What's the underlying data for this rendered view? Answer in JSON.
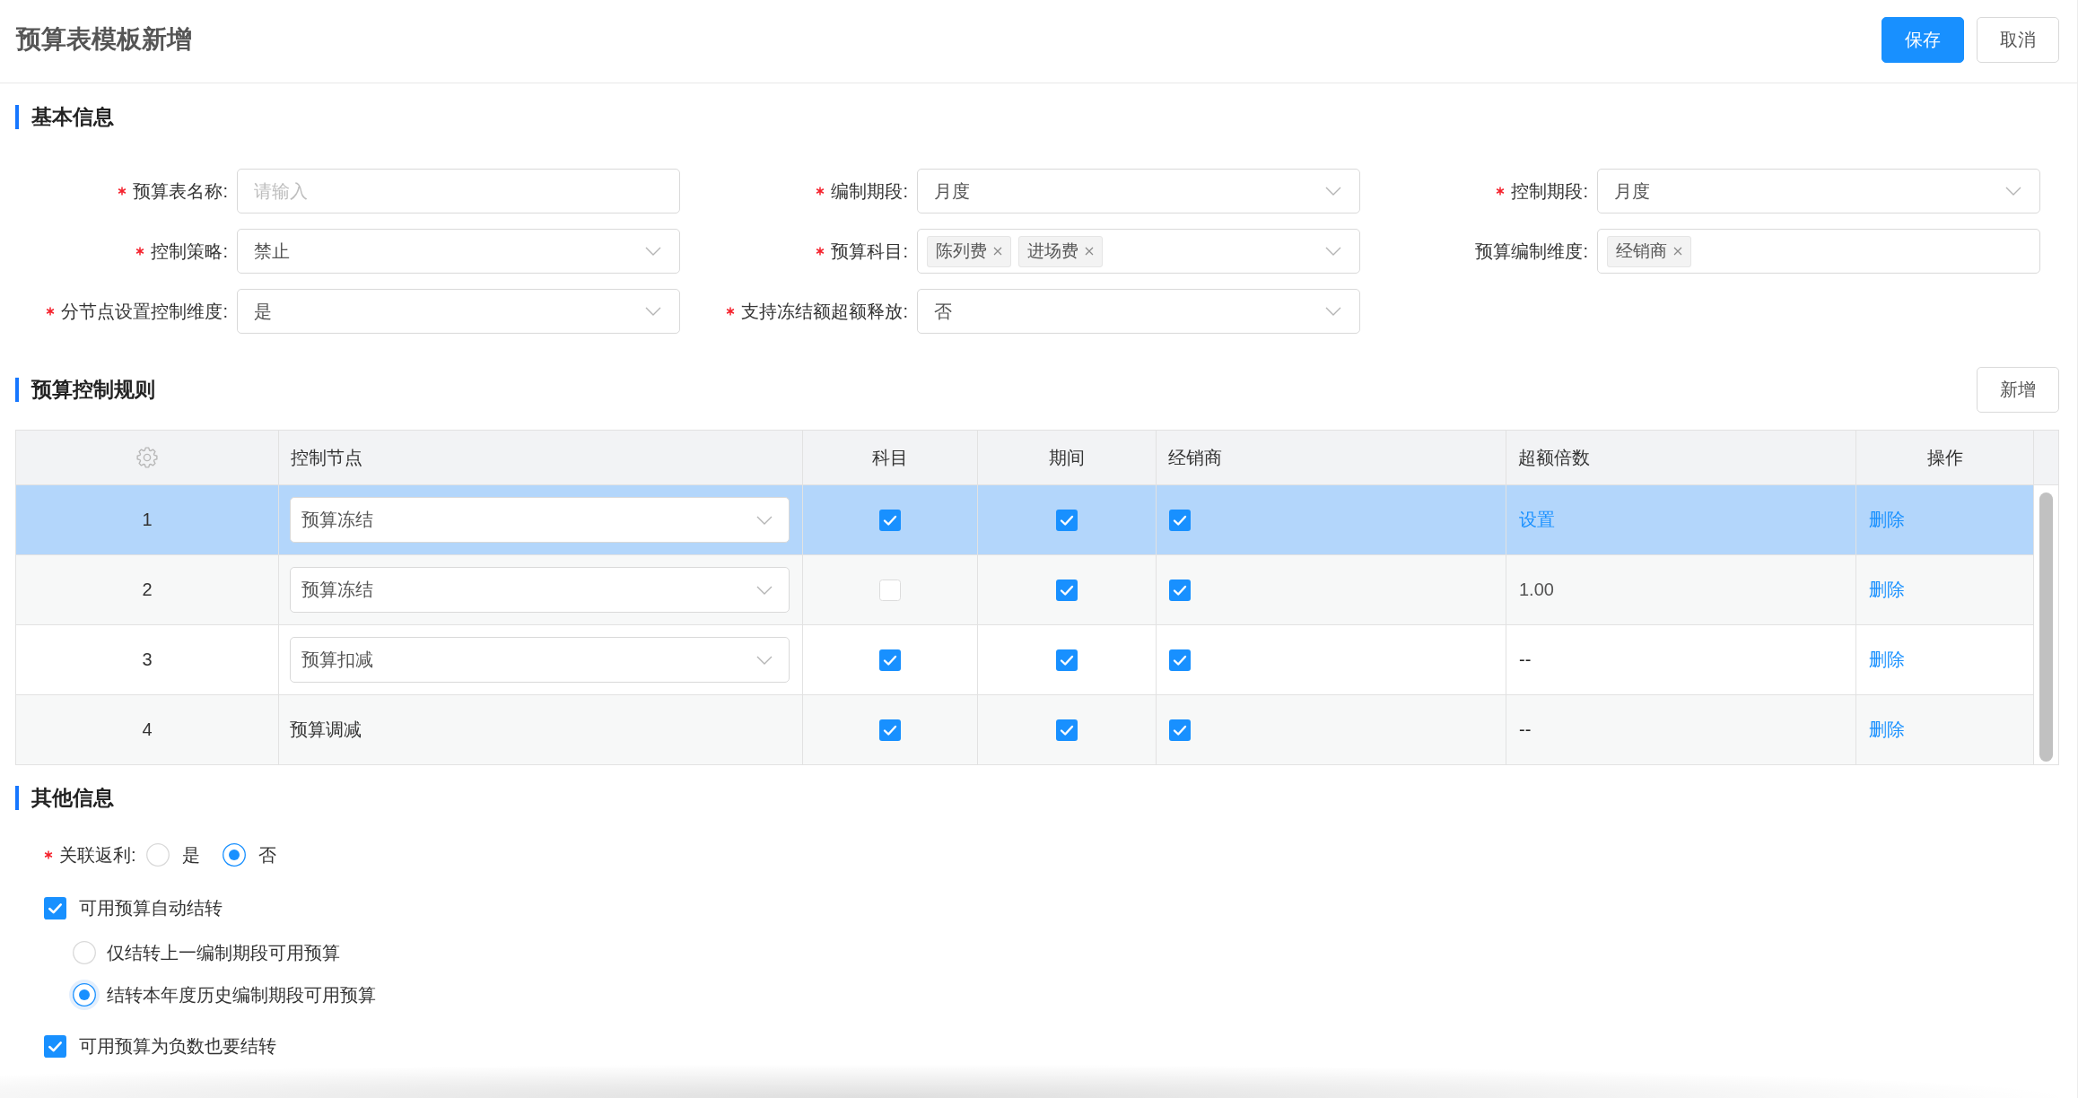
{
  "header": {
    "title": "预算表模板新增",
    "buttons": [
      {
        "label": "保存",
        "kind": "primary"
      },
      {
        "label": "取消",
        "kind": "default"
      }
    ]
  },
  "basic_info": {
    "title": "基本信息",
    "fields": [
      {
        "label": "预算表名称:",
        "required": true,
        "kind": "input",
        "placeholder": "请输入"
      },
      {
        "label": "编制期段:",
        "required": true,
        "kind": "select",
        "value": "月度"
      },
      {
        "label": "控制期段:",
        "required": true,
        "kind": "select",
        "value": "月度"
      },
      {
        "label": "控制策略:",
        "required": true,
        "kind": "select",
        "value": "禁止"
      },
      {
        "label": "预算科目:",
        "required": true,
        "kind": "tag_select",
        "tags": [
          "陈列费",
          "进场费"
        ]
      },
      {
        "label": "预算编制维度:",
        "required": false,
        "kind": "tag_input",
        "tags": [
          "经销商"
        ]
      },
      {
        "label": "分节点设置控制维度:",
        "required": true,
        "kind": "select",
        "value": "是"
      },
      {
        "label": "支持冻结额超额释放:",
        "required": true,
        "kind": "select",
        "value": "否"
      }
    ]
  },
  "control_rules": {
    "title": "预算控制规则",
    "add_button": "新增",
    "table": {
      "columns": [
        "控制节点",
        "科目",
        "期间",
        "经销商",
        "超额倍数",
        "操作"
      ],
      "rows": [
        {
          "number": "1",
          "selected": true,
          "node": {
            "kind": "select",
            "value": "预算冻结"
          },
          "subject_checked": true,
          "period_checked": true,
          "dealer_checked": true,
          "excess": {
            "kind": "link",
            "value": "设置"
          },
          "action": "删除"
        },
        {
          "number": "2",
          "selected": false,
          "node": {
            "kind": "select",
            "value": "预算冻结"
          },
          "subject_checked": false,
          "period_checked": true,
          "dealer_checked": true,
          "excess": {
            "kind": "number",
            "value": "1.00"
          },
          "action": "删除"
        },
        {
          "number": "3",
          "selected": false,
          "node": {
            "kind": "select",
            "value": "预算扣减"
          },
          "subject_checked": true,
          "period_checked": true,
          "dealer_checked": true,
          "excess": {
            "kind": "empty",
            "value": "--"
          },
          "action": "删除"
        },
        {
          "number": "4",
          "selected": false,
          "node": {
            "kind": "text",
            "value": "预算调减"
          },
          "subject_checked": true,
          "period_checked": true,
          "dealer_checked": true,
          "excess": {
            "kind": "empty",
            "value": "--"
          },
          "action": "删除"
        }
      ]
    }
  },
  "other_info": {
    "title": "其他信息",
    "rebate": {
      "label": "关联返利:",
      "required": true,
      "options": [
        {
          "label": "是",
          "selected": false
        },
        {
          "label": "否",
          "selected": true
        }
      ]
    },
    "auto_carry": {
      "label": "可用预算自动结转",
      "checked": true,
      "options": [
        {
          "label": "仅结转上一编制期段可用预算",
          "selected": false,
          "focused": false
        },
        {
          "label": "结转本年度历史编制期段可用预算",
          "selected": true,
          "focused": true
        }
      ]
    },
    "negative_carry": {
      "label": "可用预算为负数也要结转",
      "checked": true
    }
  }
}
